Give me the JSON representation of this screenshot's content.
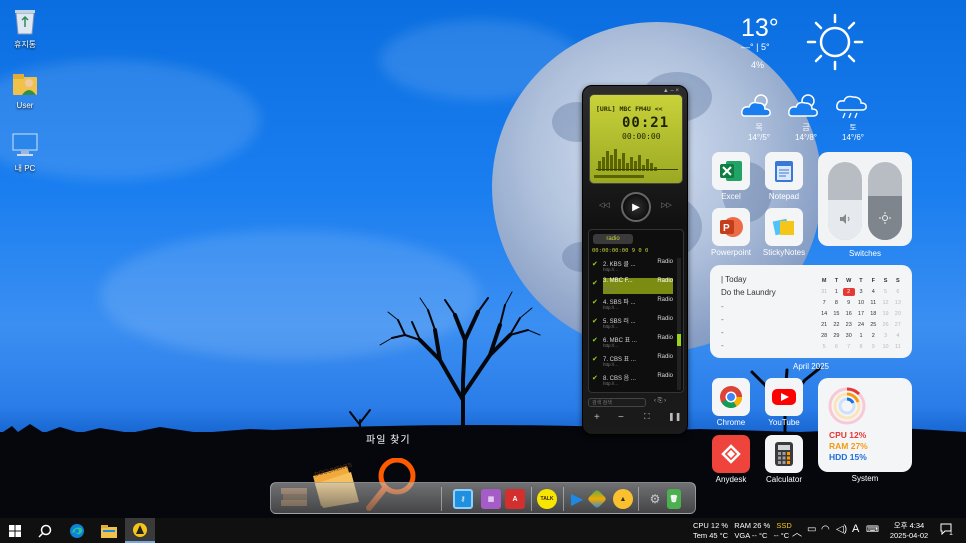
{
  "desktop": {
    "icons": [
      {
        "label": "휴지통",
        "icon": "recycle-bin-icon"
      },
      {
        "label": "User",
        "icon": "user-folder-icon"
      },
      {
        "label": "내 PC",
        "icon": "this-pc-icon"
      }
    ]
  },
  "weather": {
    "temp": "13°",
    "hilo": "—° | 5°",
    "precip": "4%",
    "icon": "sun-icon",
    "forecast": [
      {
        "day": "목",
        "range": "14°/5°",
        "icon": "partly-cloudy-icon"
      },
      {
        "day": "금",
        "range": "14°/8°",
        "icon": "partly-cloudy-icon"
      },
      {
        "day": "토",
        "range": "14°/6°",
        "icon": "rain-cloud-icon"
      }
    ]
  },
  "apps": [
    {
      "label": "Excel",
      "icon": "excel-icon",
      "color": "#1d7a45"
    },
    {
      "label": "Notepad",
      "icon": "notepad-icon",
      "color": "#3a78d8"
    },
    {
      "label": "Powerpoint",
      "icon": "powerpoint-icon",
      "color": "#d24726"
    },
    {
      "label": "StickyNotes",
      "icon": "sticky-notes-icon",
      "color": "#f5c518"
    },
    {
      "label": "Chrome",
      "icon": "chrome-icon",
      "color": "#4285f4"
    },
    {
      "label": "YouTube",
      "icon": "youtube-icon",
      "color": "#ff0000"
    },
    {
      "label": "Anydesk",
      "icon": "anydesk-icon",
      "color": "#ef443b"
    },
    {
      "label": "Calculator",
      "icon": "calculator-icon",
      "color": "#444444"
    }
  ],
  "switches": {
    "caption": "Switches"
  },
  "calendar": {
    "today_label": "| Today",
    "todo": "Do the Laundry",
    "dashes": [
      "-",
      "-",
      "-",
      "-"
    ],
    "weekdays": [
      "M",
      "T",
      "W",
      "T",
      "F",
      "S",
      "S"
    ],
    "days": [
      "31",
      "1",
      "2",
      "3",
      "4",
      "5",
      "6",
      "7",
      "8",
      "9",
      "10",
      "11",
      "12",
      "13",
      "14",
      "15",
      "16",
      "17",
      "18",
      "19",
      "20",
      "21",
      "22",
      "23",
      "24",
      "25",
      "26",
      "27",
      "28",
      "29",
      "30",
      "1",
      "2",
      "3",
      "4",
      "5",
      "6",
      "7",
      "8",
      "9",
      "10",
      "11"
    ],
    "caption": "April 2025"
  },
  "system": {
    "cpu": "CPU 12%",
    "ram": "RAM 27%",
    "hdd": "HDD 15%",
    "caption": "System",
    "colors": {
      "cpu": "#e53935",
      "ram": "#f39c12",
      "hdd": "#1e6fd9"
    }
  },
  "player": {
    "station": "[URL] MBC FM4U <<",
    "time": "00:21",
    "elapsed": "00:00:00",
    "tab": "radio",
    "info": "00:00:00:00  9     0 0",
    "tracks": [
      {
        "name": "2. KBS 클 ...",
        "kind": "Radio",
        "url": "http://..."
      },
      {
        "name": "3. MBC F...",
        "kind": "Radio",
        "url": "http://..."
      },
      {
        "name": "4. SBS 파 ...",
        "kind": "Radio",
        "url": "http://..."
      },
      {
        "name": "5. SBS 러 ...",
        "kind": "Radio",
        "url": "http://..."
      },
      {
        "name": "6. MBC 표 ...",
        "kind": "Radio",
        "url": "http://..."
      },
      {
        "name": "7. CBS 표 ...",
        "kind": "Radio",
        "url": "http://..."
      },
      {
        "name": "8. CBS 음 ...",
        "kind": "Radio",
        "url": "http://..."
      }
    ],
    "search_placeholder": "검색 검색"
  },
  "dock": {
    "file_find_label": "파일 찾기",
    "items": [
      {
        "icon": "books-icon",
        "color": "#8a5a2b",
        "text": ""
      },
      {
        "icon": "documents-folder-icon",
        "color": "#e9a23b",
        "text": ""
      },
      {
        "icon": "magnifier-icon",
        "color": "#ff5a00",
        "text": ""
      },
      {
        "icon": "usb-icon",
        "color": "#1f8fe0",
        "text": ""
      },
      {
        "icon": "calendar-grid-icon",
        "color": "#a55cc7",
        "text": ""
      },
      {
        "icon": "acrobat-icon",
        "color": "#d32f2f",
        "text": ""
      },
      {
        "icon": "kakaotalk-icon",
        "color": "#f7e600",
        "text": "TALK"
      },
      {
        "icon": "play-store-icon",
        "color": "#1e88e5",
        "text": ""
      },
      {
        "icon": "maps-icon",
        "color": "#f2a900",
        "text": ""
      },
      {
        "icon": "alzip-icon",
        "color": "#fbc02d",
        "text": ""
      },
      {
        "icon": "gears-icon",
        "color": "#777777",
        "text": ""
      },
      {
        "icon": "trash-can-icon",
        "color": "#4caf50",
        "text": ""
      }
    ]
  },
  "taskbar": {
    "items": [
      {
        "icon": "windows-start-icon"
      },
      {
        "icon": "search-icon"
      },
      {
        "icon": "edge-icon"
      },
      {
        "icon": "file-explorer-icon"
      },
      {
        "icon": "app-launcher-icon"
      }
    ],
    "stats_line1": [
      "CPU 12 %",
      "RAM 26 %",
      "SSD"
    ],
    "stats_line2": [
      "Tem 45 °C",
      "VGA -- °C",
      "-- °C"
    ],
    "tray": [
      "chevron-up-icon",
      "battery-icon",
      "wifi-icon",
      "volume-icon",
      "A",
      "keyboard-icon"
    ],
    "time": "오후 4:34",
    "date": "2025-04-02",
    "notif_count": "1"
  }
}
